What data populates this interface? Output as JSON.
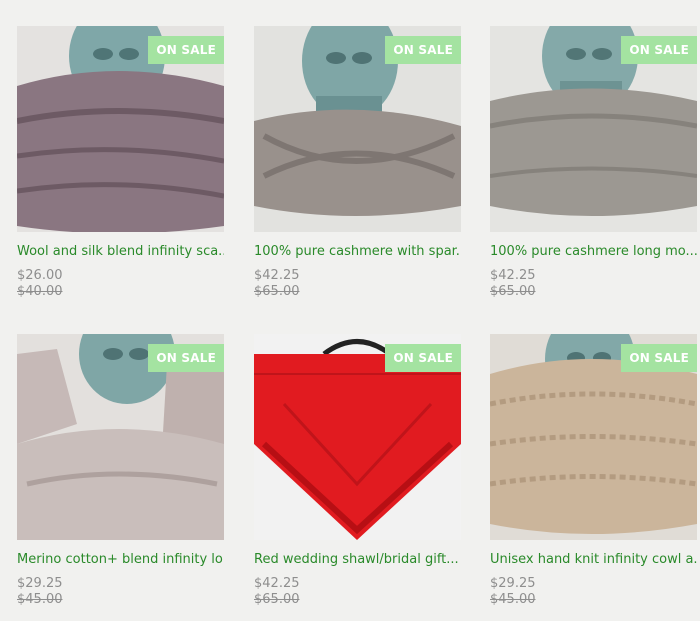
{
  "badge_label": "ON SALE",
  "colors": {
    "background": "#f1f1ef",
    "badge": "#a4e3a1",
    "title": "#2a8a2a",
    "price": "#8e8e8e"
  },
  "products": [
    {
      "title": "Wool and silk blend infinity sca...",
      "price": "$26.00",
      "old_price": "$40.00",
      "image": "purple-infinity-scarf-on-glass-head"
    },
    {
      "title": "100% pure cashmere with spar...",
      "price": "$42.25",
      "old_price": "$65.00",
      "image": "gray-twisted-cashmere-cowl-on-glass-head"
    },
    {
      "title": "100% pure cashmere long mo...",
      "price": "$42.25",
      "old_price": "$65.00",
      "image": "gray-cashmere-cowl-on-glass-head"
    },
    {
      "title": "Merino cotton+ blend infinity lo...",
      "price": "$29.25",
      "old_price": "$45.00",
      "image": "light-mauve-infinity-loop-on-glass-head"
    },
    {
      "title": "Red wedding shawl/bridal gift...",
      "price": "$42.25",
      "old_price": "$65.00",
      "image": "red-lace-shawl-on-hanger"
    },
    {
      "title": "Unisex hand knit infinity cowl a...",
      "price": "$29.25",
      "old_price": "$45.00",
      "image": "beige-textured-cowl-on-glass-head"
    }
  ]
}
